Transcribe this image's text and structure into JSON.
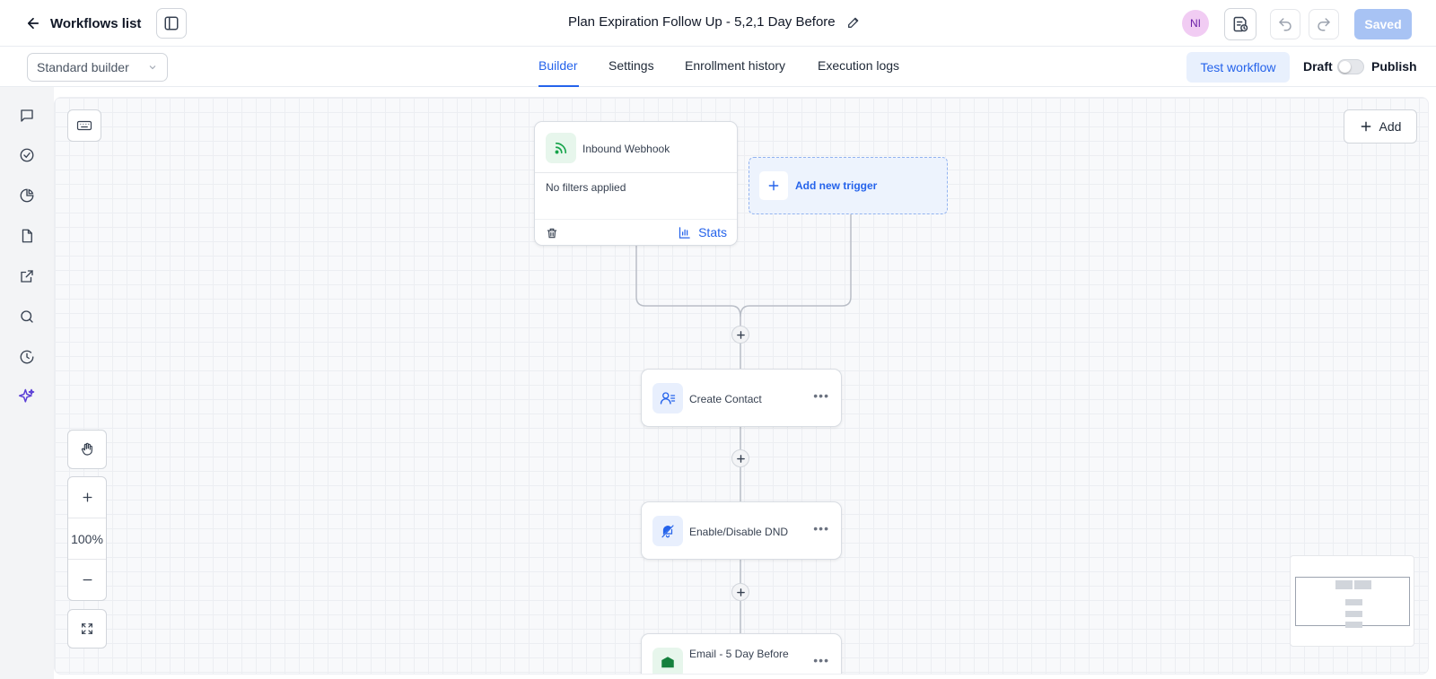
{
  "header": {
    "back_label": "Workflows list",
    "title": "Plan Expiration Follow Up - 5,2,1 Day Before",
    "avatar_initials": "NI",
    "saved_label": "Saved"
  },
  "subbar": {
    "builder_select": "Standard builder",
    "tabs": [
      "Builder",
      "Settings",
      "Enrollment history",
      "Execution logs"
    ],
    "active_tab": "Builder",
    "test_workflow_label": "Test workflow",
    "draft_label": "Draft",
    "publish_label": "Publish"
  },
  "canvas": {
    "add_label": "Add",
    "zoom_level": "100%",
    "trigger": {
      "title": "Inbound Webhook",
      "filter_text": "No filters applied",
      "stats_label": "Stats"
    },
    "add_trigger_label": "Add new trigger",
    "actions": [
      {
        "title": "Create Contact",
        "icon": "contact-icon"
      },
      {
        "title": "Enable/Disable DND",
        "icon": "bell-off-icon"
      },
      {
        "title": "Email - 5 Day Before",
        "icon": "email-icon"
      }
    ]
  },
  "sidebar": {
    "icons": [
      "chat-icon",
      "check-circle-icon",
      "pie-chart-icon",
      "document-icon",
      "external-link-icon",
      "search-icon",
      "clock-history-icon",
      "sparkles-icon"
    ]
  },
  "colors": {
    "accent": "#2563eb",
    "saved_button": "#a8c3f4",
    "avatar_bg": "#f1ccf3",
    "sparkle": "#5b3fd6"
  }
}
